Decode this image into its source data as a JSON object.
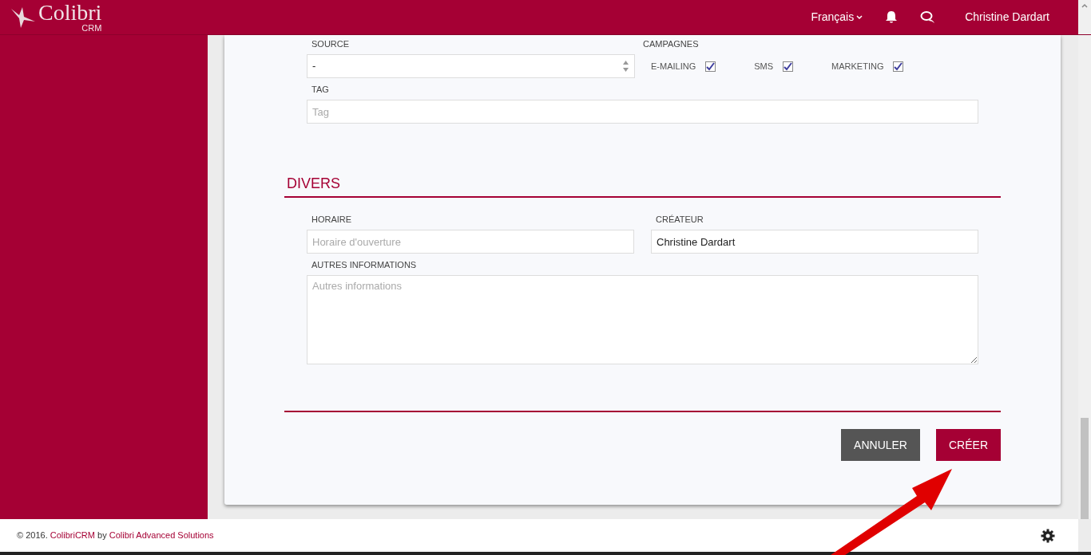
{
  "header": {
    "logo": "Colibri",
    "logo_sub": "CRM",
    "language": "Français",
    "user": "Christine Dardart"
  },
  "source": {
    "label": "SOURCE",
    "value": "-"
  },
  "campaigns": {
    "label": "CAMPAGNES",
    "options": [
      {
        "label": "E-MAILING",
        "checked": true
      },
      {
        "label": "SMS",
        "checked": true
      },
      {
        "label": "MARKETING",
        "checked": true
      }
    ]
  },
  "tag": {
    "label": "TAG",
    "placeholder": "Tag"
  },
  "section": {
    "title": "DIVERS",
    "horaire": {
      "label": "HORAIRE",
      "placeholder": "Horaire d'ouverture"
    },
    "createur": {
      "label": "CRÉATEUR",
      "value": "Christine Dardart"
    },
    "autres": {
      "label": "AUTRES INFORMATIONS",
      "placeholder": "Autres informations"
    }
  },
  "buttons": [
    {
      "label": "ANNULER",
      "kind": "secondary"
    },
    {
      "label": "CRÉER",
      "kind": "primary"
    }
  ],
  "footer": {
    "prefix": "© 2016.",
    "link1": "ColibriCRM",
    "middle": "by",
    "link2": "Colibri Advanced Solutions"
  }
}
